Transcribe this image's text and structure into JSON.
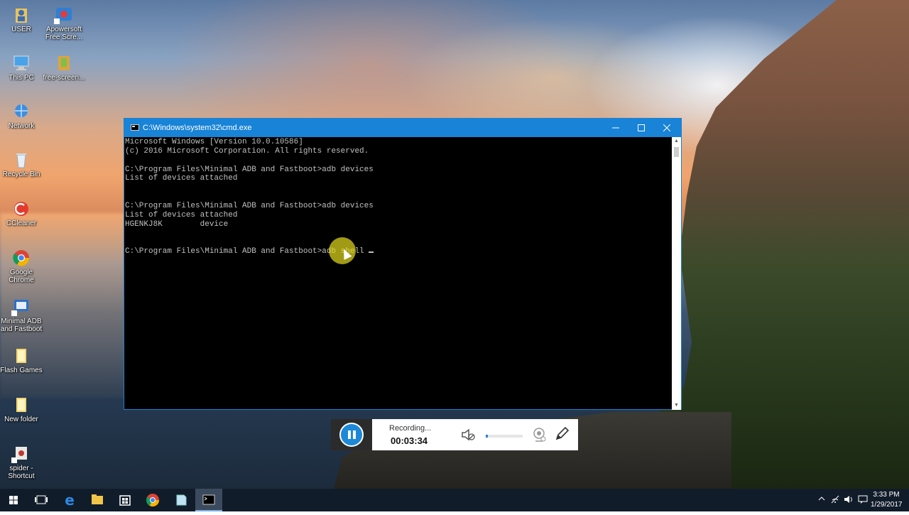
{
  "desktop_icons": [
    {
      "label": "USER",
      "icon": "user-folder-icon"
    },
    {
      "label": "Apowersoft Free Scre...",
      "icon": "apowersoft-icon"
    },
    {
      "label": "This PC",
      "icon": "this-pc-icon"
    },
    {
      "label": "free-screen...",
      "icon": "archive-icon"
    },
    {
      "label": "Network",
      "icon": "network-icon"
    },
    {
      "label": "Recycle Bin",
      "icon": "recycle-bin-icon"
    },
    {
      "label": "CCleaner",
      "icon": "ccleaner-icon"
    },
    {
      "label": "Google Chrome",
      "icon": "chrome-icon"
    },
    {
      "label": "Minimal ADB and Fastboot",
      "icon": "adb-icon"
    },
    {
      "label": "Flash Games",
      "icon": "folder-icon"
    },
    {
      "label": "New folder",
      "icon": "folder-icon"
    },
    {
      "label": "spider - Shortcut",
      "icon": "spider-icon"
    }
  ],
  "cmd": {
    "title": "C:\\Windows\\system32\\cmd.exe",
    "lines": [
      "Microsoft Windows [Version 10.0.10586]",
      "(c) 2016 Microsoft Corporation. All rights reserved.",
      "",
      "C:\\Program Files\\Minimal ADB and Fastboot>adb devices",
      "List of devices attached",
      "",
      "",
      "C:\\Program Files\\Minimal ADB and Fastboot>adb devices",
      "List of devices attached",
      "HGENKJ8K        device",
      "",
      ""
    ],
    "prompt": "C:\\Program Files\\Minimal ADB and Fastboot>adb shell "
  },
  "recorder": {
    "status": "Recording...",
    "time": "00:03:34",
    "volume": 0.05
  },
  "taskbar": {
    "time": "3:33 PM",
    "date": "1/29/2017"
  },
  "colors": {
    "titlebar": "#1883d7",
    "taskbar": "#111c2a",
    "recorder_accent": "#1e88d8"
  }
}
